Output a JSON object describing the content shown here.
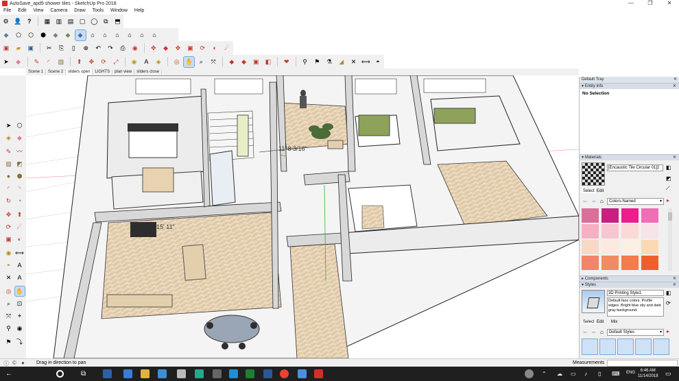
{
  "window": {
    "title": "AutoSave_apd9 shower tiles - SketchUp Pro 2018",
    "minimize": "—",
    "restore": "❐",
    "close": "✕"
  },
  "menu": [
    "File",
    "Edit",
    "View",
    "Camera",
    "Draw",
    "Tools",
    "Window",
    "Help"
  ],
  "scenes": [
    "Scene 1",
    "Scene 2",
    "sliders open",
    "LIGHTS",
    "plan view",
    "sliders close"
  ],
  "dimension_label": "11' 8 3/16\"",
  "text_label": "15' 11\"",
  "tray": {
    "title": "Default Tray",
    "entity_info": {
      "header": "Entity Info",
      "value": "No Selection"
    },
    "materials": {
      "header": "Materials",
      "name": "[Encaustic Tile Circular 01]2",
      "tabs": [
        "Select",
        "Edit"
      ],
      "library": "Colors-Named",
      "swatches": [
        "#d8709a",
        "#c81f80",
        "#ec1d8c",
        "#ef6eb4",
        "#f6b0c1",
        "#f7c6cf",
        "#fbd9d6",
        "#f6e4e9",
        "#f7d9c6",
        "#fbeadf",
        "#fcefe5",
        "#fbd9b2",
        "#f2846c",
        "#f28b62",
        "#f47b4a",
        "#f05f2a"
      ]
    },
    "components": {
      "header": "Components"
    },
    "styles": {
      "header": "Styles",
      "name": "3D Printing Style1",
      "description": "Default face colors. Profile edges. Bright blue sky and dark gray background.",
      "tabs": [
        "Select",
        "Edit",
        "Mix"
      ],
      "library": "Default Styles"
    }
  },
  "status": {
    "message": "Drag in direction to pan",
    "measurements_label": "Measurements",
    "measurements_value": ""
  },
  "taskbar": {
    "lang": "ENG",
    "time": "6:46 AM",
    "date": "11/14/2018"
  }
}
